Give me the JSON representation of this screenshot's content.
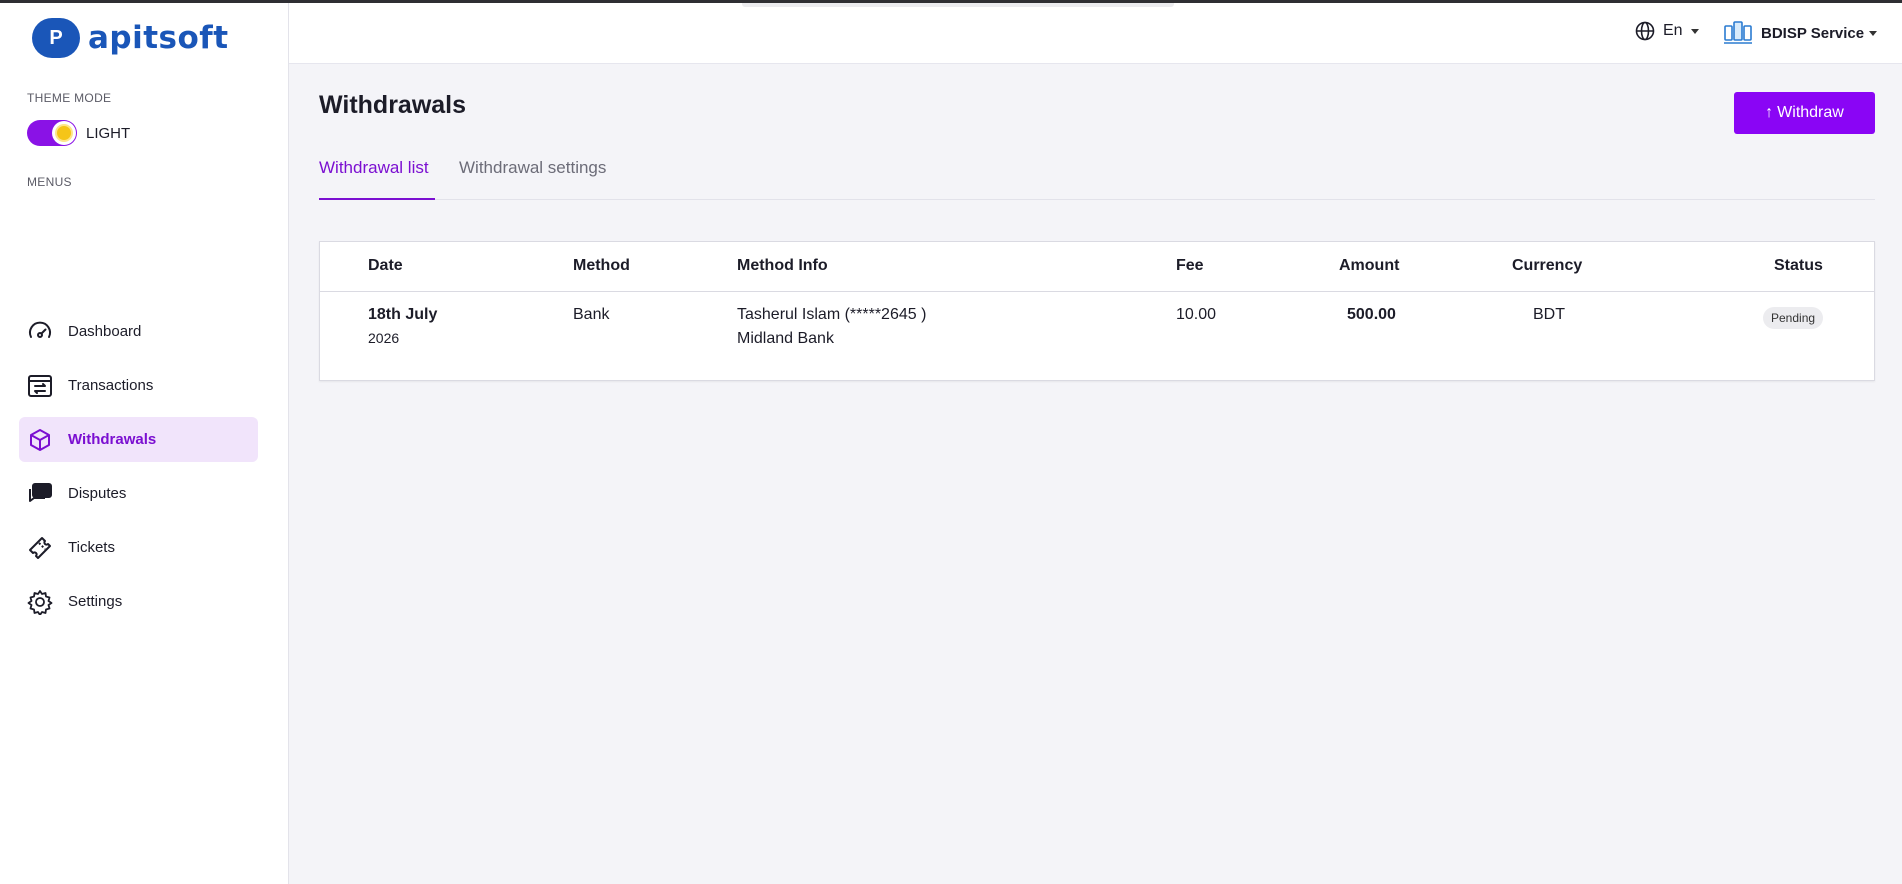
{
  "brand": {
    "logo_mark": "P",
    "name": "apitsoft"
  },
  "sidebar": {
    "theme_mode_label": "THEME MODE",
    "theme_value": "LIGHT",
    "menus_label": "MENUS",
    "items": [
      {
        "label": "Dashboard",
        "icon": "speedometer-icon"
      },
      {
        "label": "Transactions",
        "icon": "transactions-icon"
      },
      {
        "label": "Withdrawals",
        "icon": "withdraw-box-icon",
        "active": true
      },
      {
        "label": "Disputes",
        "icon": "chat-icon"
      },
      {
        "label": "Tickets",
        "icon": "ticket-icon"
      },
      {
        "label": "Settings",
        "icon": "gear-icon"
      }
    ]
  },
  "header": {
    "language": "En",
    "account_name": "BDISP Service"
  },
  "page": {
    "title": "Withdrawals",
    "withdraw_button": "Withdraw",
    "tabs": [
      "Withdrawal list",
      "Withdrawal settings"
    ]
  },
  "table": {
    "columns": [
      "Date",
      "Method",
      "Method Info",
      "Fee",
      "Amount",
      "Currency",
      "Status"
    ],
    "rows": [
      {
        "date_day": "18th July",
        "date_year": "2026",
        "method": "Bank",
        "info_line1": "Tasherul Islam (*****2645 )",
        "info_line2": "Midland Bank",
        "fee": "10.00",
        "amount": "500.00",
        "currency": "BDT",
        "status": "Pending"
      }
    ]
  },
  "colors": {
    "accent": "#8a05f5",
    "brand_blue": "#1a56b8",
    "active_bg": "#f1e4fb"
  }
}
